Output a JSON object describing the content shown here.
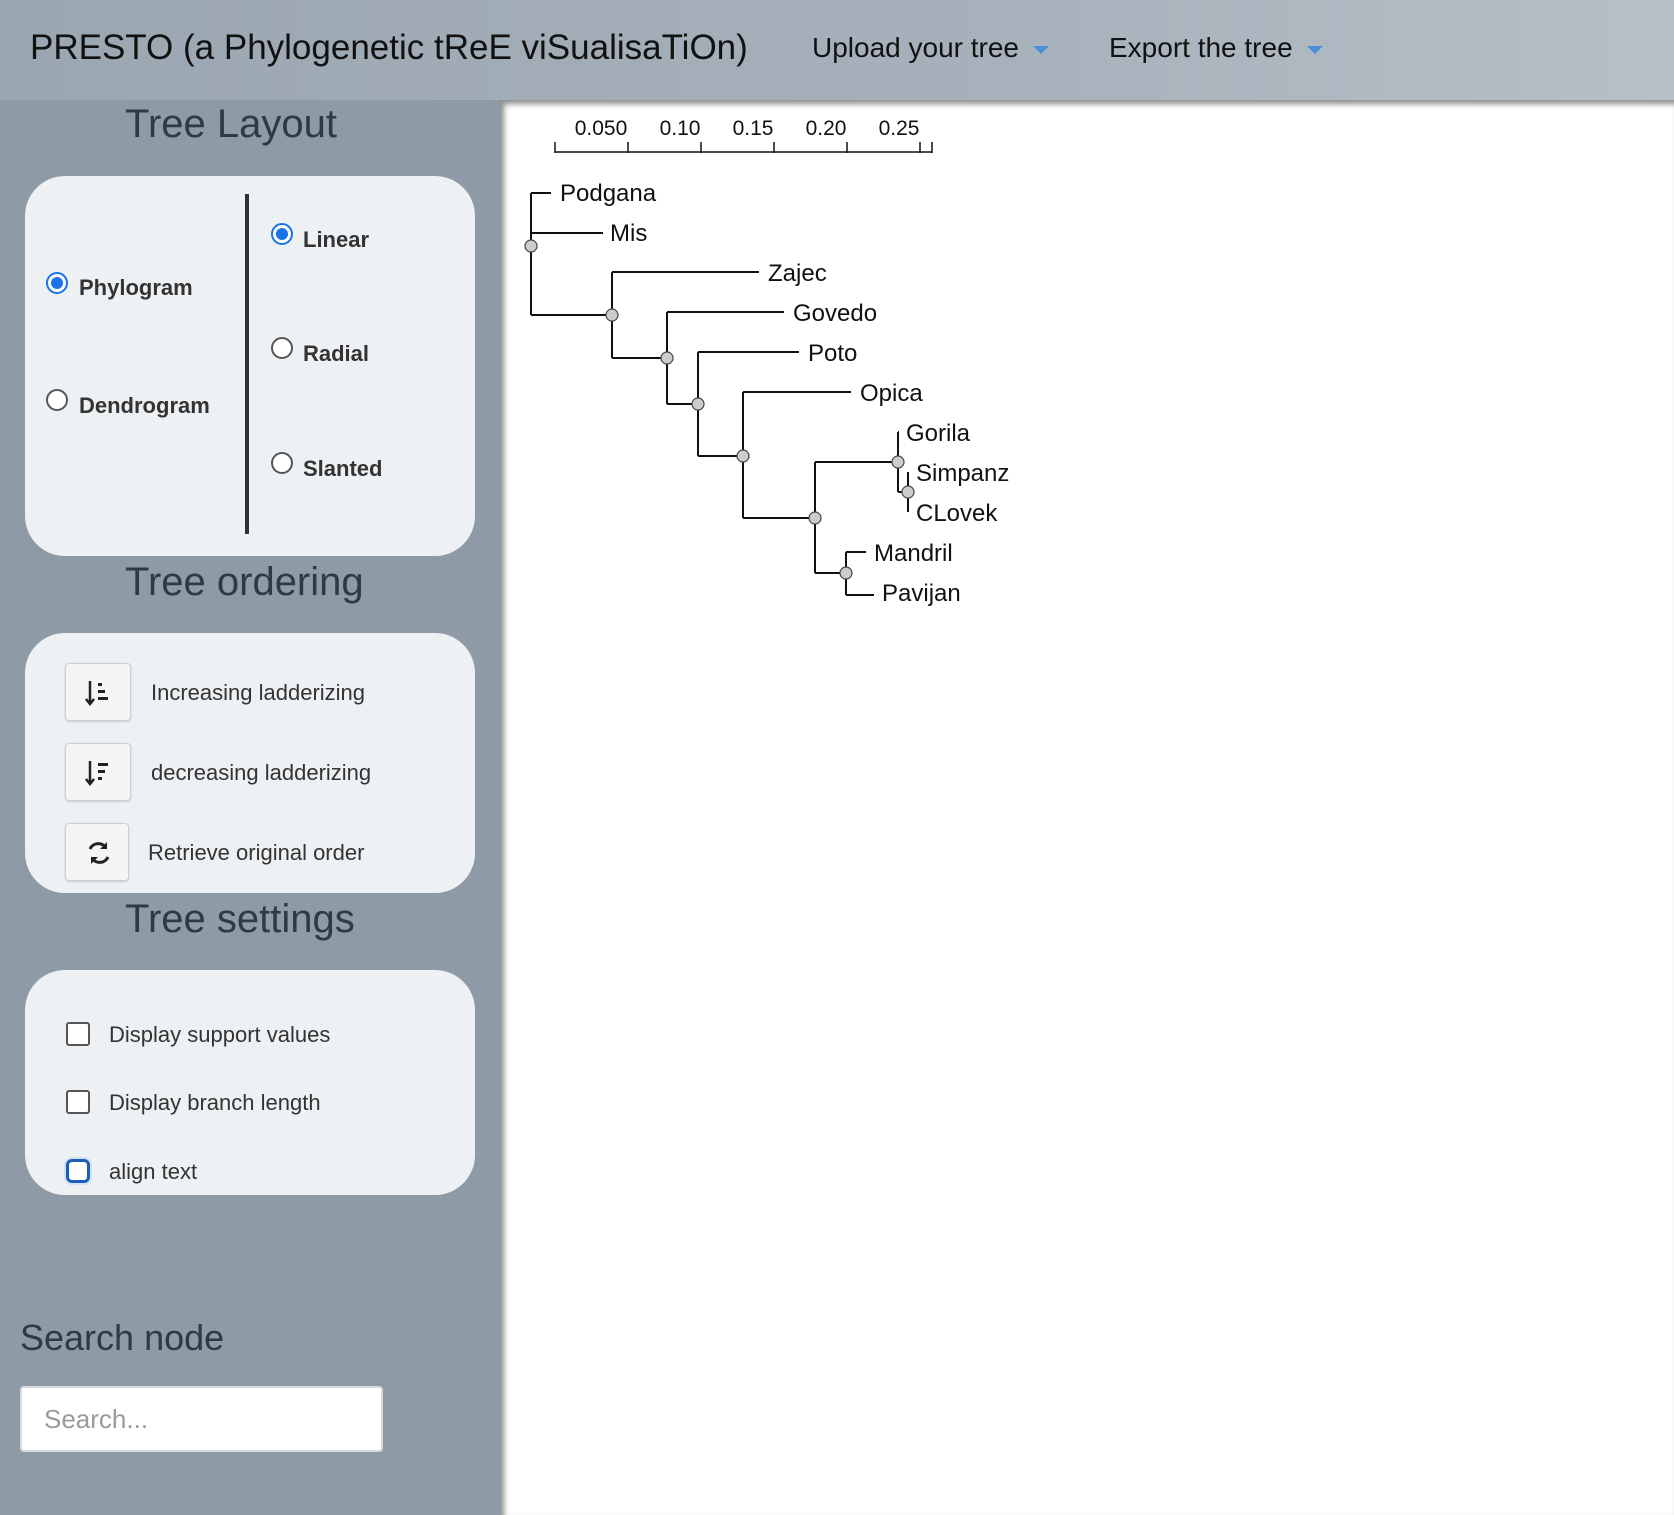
{
  "header": {
    "title": "PRESTO (a Phylogenetic tReE viSualisaTiOn)",
    "menus": [
      {
        "label": "Upload your tree"
      },
      {
        "label": "Export the tree"
      }
    ]
  },
  "sidebar": {
    "layout": {
      "title": "Tree Layout",
      "tree_types": [
        {
          "label": "Phylogram",
          "checked": true
        },
        {
          "label": "Dendrogram",
          "checked": false
        }
      ],
      "shapes": [
        {
          "label": "Linear",
          "checked": true
        },
        {
          "label": "Radial",
          "checked": false
        },
        {
          "label": "Slanted",
          "checked": false
        }
      ]
    },
    "ordering": {
      "title": "Tree ordering",
      "buttons": [
        {
          "label": "Increasing ladderizing",
          "icon": "sort-ascending-icon"
        },
        {
          "label": "decreasing ladderizing",
          "icon": "sort-descending-icon"
        },
        {
          "label": "Retrieve original order",
          "icon": "refresh-icon"
        }
      ]
    },
    "settings": {
      "title": "Tree settings",
      "options": [
        {
          "label": "Display support values",
          "checked": false
        },
        {
          "label": "Display branch length",
          "checked": false
        },
        {
          "label": "align text",
          "checked": false,
          "focused": true
        }
      ]
    },
    "search": {
      "title": "Search node",
      "placeholder": "Search..."
    }
  },
  "tree": {
    "scale_ticks": [
      "0.050",
      "0.10",
      "0.15",
      "0.20",
      "0.25"
    ],
    "leaves": [
      "Podgana",
      "Mis",
      "Zajec",
      "Govedo",
      "Poto",
      "Opica",
      "Gorila",
      "Simpanz",
      "CLovek",
      "Mandril",
      "Pavijan"
    ]
  },
  "colors": {
    "accent": "#1a73e8",
    "sidebar_bg": "#8e9aa6",
    "panel_bg": "#eef1f3",
    "caret": "#4a90d9"
  }
}
